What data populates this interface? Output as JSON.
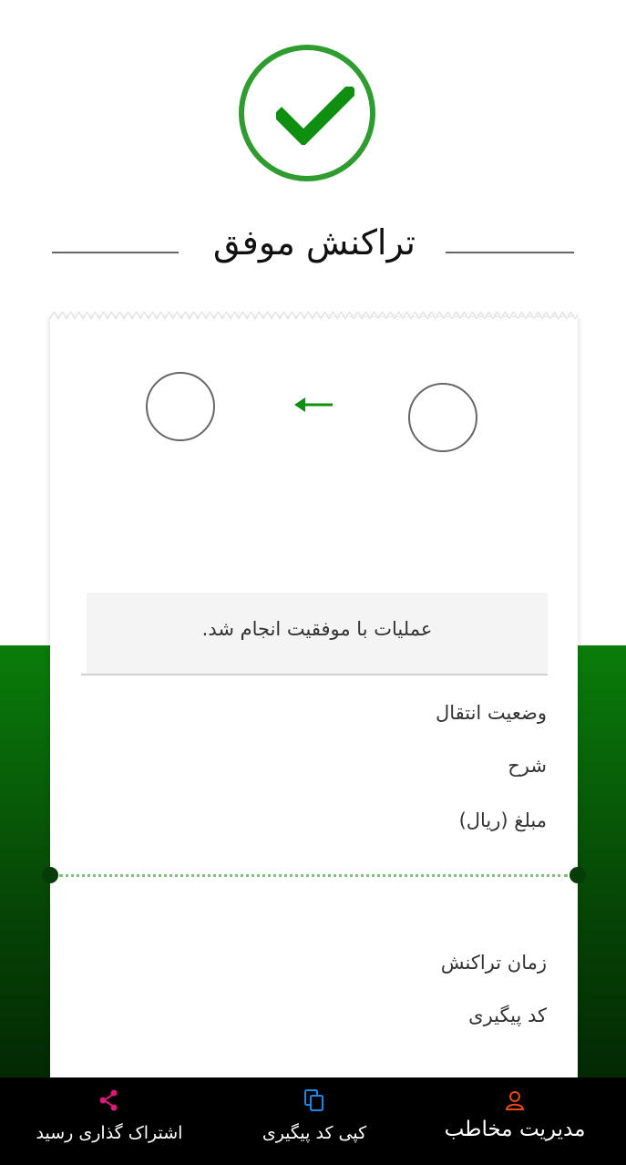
{
  "header": {
    "title": "تراکنش موفق"
  },
  "receipt": {
    "message": "عملیات با موفقیت انجام شد.",
    "labels": {
      "transfer_status": "وضعیت انتقال",
      "description": "شرح",
      "amount": "مبلغ (ریال)",
      "transaction_time": "زمان تراکنش",
      "tracking_code": "کد پیگیری"
    }
  },
  "bottom_nav": {
    "share_label": "اشتراک گذاری رسید",
    "copy_label": "کپی کد پیگیری",
    "contacts_label": "مدیریت مخاطب"
  },
  "colors": {
    "success_green": "#2e9c2e",
    "bg_green": "#0a7d0a",
    "share_icon": "#d81b7a",
    "copy_icon": "#1e88e5",
    "contacts_icon": "#e64a19"
  },
  "icons": {
    "status": "checkmark-icon",
    "direction": "arrow-left-icon",
    "share": "share-icon",
    "copy": "copy-icon",
    "contacts": "person-icon"
  }
}
